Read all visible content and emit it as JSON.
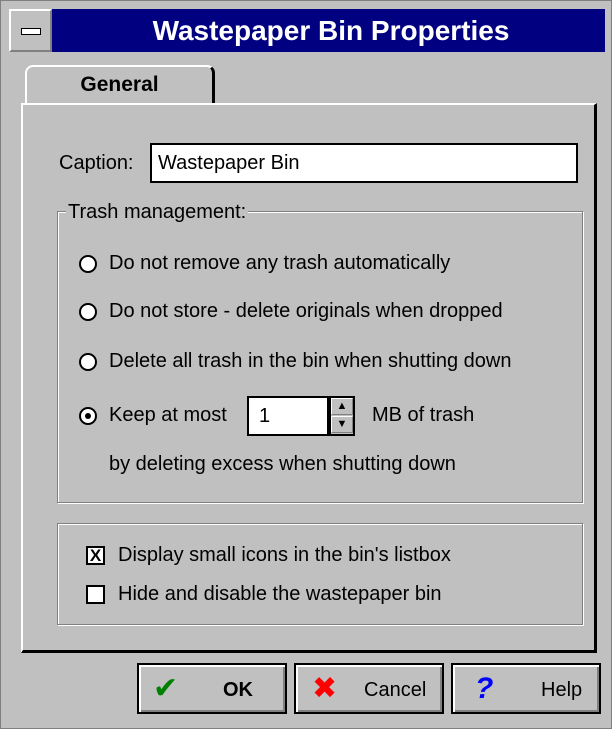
{
  "window": {
    "title": "Wastepaper Bin Properties"
  },
  "tabs": [
    {
      "label": "General"
    }
  ],
  "caption": {
    "label": "Caption:",
    "value": "Wastepaper Bin"
  },
  "trash_management": {
    "title": "Trash management:",
    "options": [
      {
        "label": "Do not remove any trash automatically",
        "selected": false
      },
      {
        "label": "Do not store - delete originals when dropped",
        "selected": false
      },
      {
        "label": "Delete all trash in the bin when shutting down",
        "selected": false
      },
      {
        "label": "Keep at most",
        "selected": true
      }
    ],
    "keep_value": "1",
    "keep_unit": "MB of trash",
    "keep_note": "by deleting excess when shutting down"
  },
  "options": {
    "small_icons": {
      "label": "Display small icons in the bin's listbox",
      "checked": true,
      "mark": "X"
    },
    "hide_bin": {
      "label": "Hide and disable the wastepaper bin",
      "checked": false
    }
  },
  "buttons": {
    "ok": {
      "label": "OK",
      "icon": "check-icon",
      "glyph": "✔"
    },
    "cancel": {
      "label": "Cancel",
      "icon": "cross-icon",
      "glyph": "✖"
    },
    "help": {
      "label": "Help",
      "icon": "question-icon",
      "glyph": "?"
    }
  },
  "colors": {
    "title_bar": "#000080",
    "face": "#c0c0c0",
    "ok_icon": "#008000",
    "cancel_icon": "#ff0000",
    "help_icon": "#0000ff"
  }
}
